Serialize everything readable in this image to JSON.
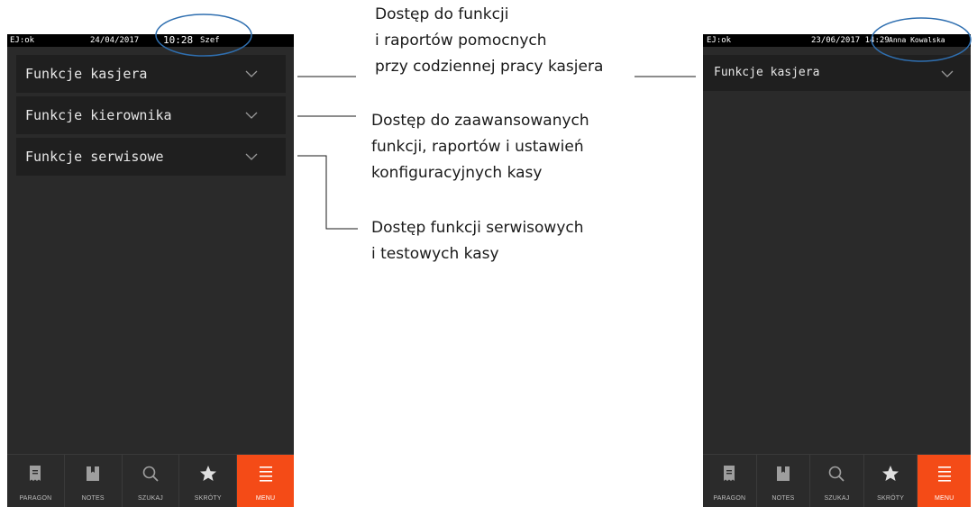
{
  "left_device": {
    "status": {
      "ej": "EJ:ok",
      "date": "24/04/2017",
      "time": "10:28",
      "user": "Szef"
    },
    "menu_items": [
      {
        "label": "Funkcje kasjera"
      },
      {
        "label": "Funkcje kierownika"
      },
      {
        "label": "Funkcje serwisowe"
      }
    ],
    "tabs": [
      {
        "label": "PARAGON",
        "icon": "receipt-icon"
      },
      {
        "label": "NOTES",
        "icon": "notes-icon"
      },
      {
        "label": "SZUKAJ",
        "icon": "search-icon"
      },
      {
        "label": "SKRÓTY",
        "icon": "star-icon"
      },
      {
        "label": "MENU",
        "icon": "menu-icon"
      }
    ]
  },
  "right_device": {
    "status": {
      "ej": "EJ:ok",
      "datetime": "23/06/2017 14:29",
      "user": "Anna Kowalska"
    },
    "menu_items": [
      {
        "label": "Funkcje kasjera"
      }
    ],
    "tabs": [
      {
        "label": "PARAGON",
        "icon": "receipt-icon"
      },
      {
        "label": "NOTES",
        "icon": "notes-icon"
      },
      {
        "label": "SZUKAJ",
        "icon": "search-icon"
      },
      {
        "label": "SKRÓTY",
        "icon": "star-icon"
      },
      {
        "label": "MENU",
        "icon": "menu-icon"
      }
    ]
  },
  "annotations": {
    "cashier": {
      "line1": "Dostęp do funkcji",
      "line2": "i raportów pomocnych",
      "line3": "przy codziennej pracy kasjera"
    },
    "manager": {
      "line1": "Dostęp do zaawansowanych",
      "line2": "funkcji, raportów i ustawień",
      "line3": "konfiguracyjnych kasy"
    },
    "service": {
      "line1": "Dostęp funkcji serwisowych",
      "line2": "i testowych kasy"
    }
  },
  "colors": {
    "accent": "#f44b17",
    "device_bg": "#2a2a2a",
    "item_bg": "#1f1f1f",
    "highlight_ring": "#2f6fb0"
  }
}
